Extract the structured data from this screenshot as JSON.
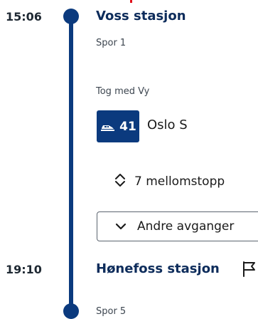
{
  "departure": {
    "time": "15:06",
    "station": "Voss stasjon",
    "platform": "Spor 1"
  },
  "leg": {
    "operator": "Tog med Vy",
    "transport_icon": "train-icon",
    "line_number": "41",
    "destination": "Oslo S",
    "stops_icon": "expand-collapse-icon",
    "stops_label": "7 mellomstopp",
    "other_departures_icon": "chevron-down-icon",
    "other_departures_label": "Andre avganger"
  },
  "arrival": {
    "time": "19:10",
    "station": "Hønefoss stasjon",
    "destination_icon": "flag-icon",
    "platform": "Spor 5"
  },
  "colors": {
    "brand_blue": "#0b3a7e",
    "station_text": "#0d2c5b",
    "accent_red": "#e0101a"
  }
}
